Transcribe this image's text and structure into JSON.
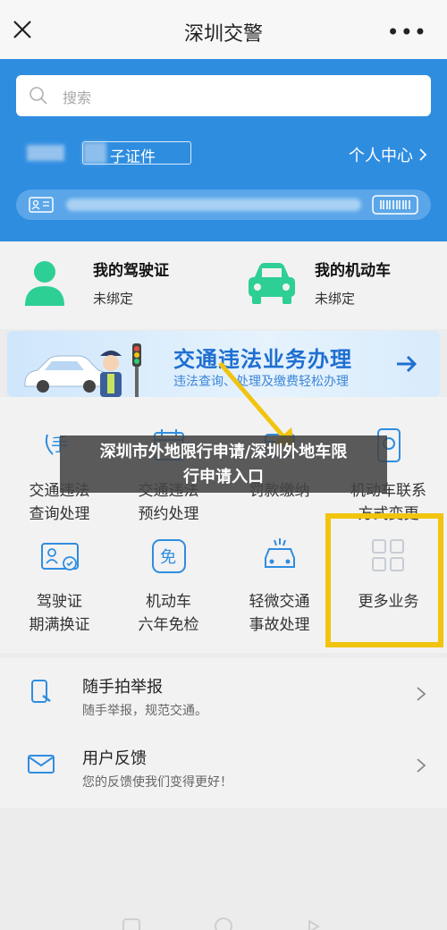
{
  "topbar": {
    "title": "深圳交警",
    "close_icon": "close-icon",
    "more_icon": "more-dots-icon",
    "more_glyph": "•••"
  },
  "header": {
    "search_placeholder": "搜索",
    "doc_label": "子证件",
    "personal_center": "个人中心",
    "accent": "#2f8de0"
  },
  "licenses": [
    {
      "title": "我的驾驶证",
      "status": "未绑定",
      "icon": "user-icon"
    },
    {
      "title": "我的机动车",
      "status": "未绑定",
      "icon": "car-icon"
    }
  ],
  "banner": {
    "title": "交通违法业务办理",
    "subtitle": "违法查询、处理及缴费轻松办理",
    "icon": "arrow-right-icon"
  },
  "services": [
    {
      "label1": "交通违法",
      "label2": "查询处理",
      "icon": "violation-icon"
    },
    {
      "label1": "交通违法",
      "label2": "预约处理",
      "icon": "calendar-icon"
    },
    {
      "label1": "罚款缴纳",
      "label2": "",
      "icon": "payment-icon"
    },
    {
      "label1": "机动车联系",
      "label2": "方式变更",
      "icon": "phone-icon"
    },
    {
      "label1": "驾驶证",
      "label2": "期满换证",
      "icon": "license-card-icon"
    },
    {
      "label1": "机动车",
      "label2": "六年免检",
      "icon": "exempt-icon"
    },
    {
      "label1": "轻微交通",
      "label2": "事故处理",
      "icon": "accident-icon"
    },
    {
      "label1": "更多业务",
      "label2": "",
      "icon": "grid-icon"
    }
  ],
  "overlay": {
    "line1": "深圳市外地限行申请/深圳外地车限",
    "line2": "行申请入口"
  },
  "list": [
    {
      "title": "随手拍举报",
      "subtitle": "随手举报，规范交通。",
      "icon": "report-icon"
    },
    {
      "title": "用户反馈",
      "subtitle": "您的反馈使我们变得更好！",
      "icon": "mail-icon"
    }
  ],
  "colors": {
    "highlight": "#f1c40f",
    "green": "#2ecf95",
    "blue": "#2f8de0"
  }
}
